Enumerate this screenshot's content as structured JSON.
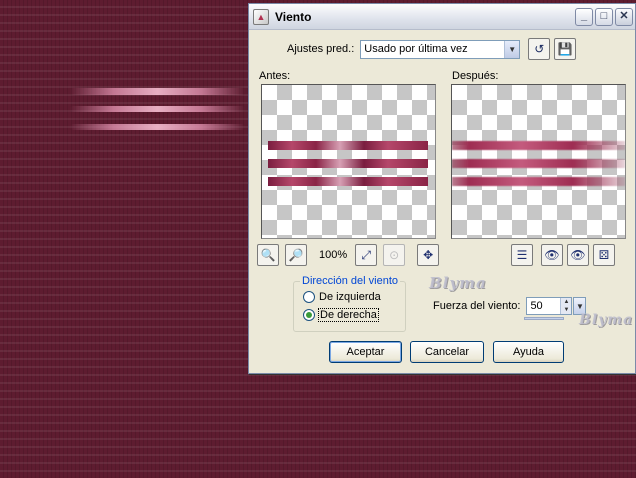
{
  "window": {
    "title": "Viento",
    "minimize": "_",
    "maximize": "□",
    "close": "✕"
  },
  "presets": {
    "label": "Ajustes pred.:",
    "value": "Usado por última vez"
  },
  "preview": {
    "before_label": "Antes:",
    "after_label": "Después:",
    "zoom": "100%"
  },
  "direction": {
    "legend": "Dirección del viento",
    "left_label": "De izquierda",
    "right_label": "De derecha",
    "selected": "right"
  },
  "strength": {
    "label": "Fuerza del viento:",
    "value": "50"
  },
  "buttons": {
    "ok": "Aceptar",
    "cancel": "Cancelar",
    "help": "Ayuda"
  },
  "watermarks": {
    "main": "Blyma",
    "secondary": "Blyma"
  },
  "icons": {
    "app": "paint-app-icon",
    "preset_reset": "reset-arrow-icon",
    "preset_save": "floppy-disk-icon",
    "zoom_out": "zoom-out-icon",
    "zoom_in": "zoom-in-icon",
    "fit": "fit-window-icon",
    "proof": "magnifier-disabled-icon",
    "move": "move-crosshair-icon",
    "preview_layout": "layout-icon",
    "lock_eye": "eye-lock-icon",
    "eye": "eye-icon",
    "random": "dice-icon"
  },
  "colors": {
    "background": "#5e1c30",
    "dialog": "#ece9d8",
    "legend_text": "#0046d5"
  }
}
